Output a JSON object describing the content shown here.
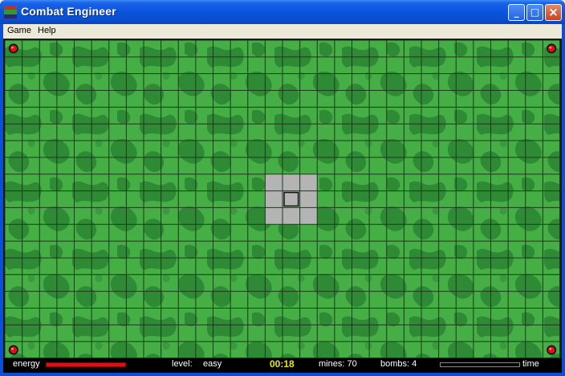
{
  "window": {
    "title": "Combat Engineer",
    "controls": {
      "minimize": "minimize",
      "maximize": "maximize",
      "close": "close"
    }
  },
  "menu": {
    "items": [
      "Game",
      "Help"
    ]
  },
  "board": {
    "columns": 32,
    "rows": 19,
    "revealed_cells": [
      {
        "col": 15,
        "row": 8
      },
      {
        "col": 16,
        "row": 8
      },
      {
        "col": 17,
        "row": 8
      },
      {
        "col": 15,
        "row": 9
      },
      {
        "col": 16,
        "row": 9
      },
      {
        "col": 17,
        "row": 9
      },
      {
        "col": 15,
        "row": 10
      },
      {
        "col": 16,
        "row": 10
      },
      {
        "col": 17,
        "row": 10
      }
    ],
    "player_cell": {
      "col": 16,
      "row": 9
    },
    "corner_markers": [
      "top-left",
      "top-right",
      "bottom-left",
      "bottom-right"
    ],
    "colors": {
      "grass_light": "#44b044",
      "grass_dark": "#2f8a36",
      "grid_line": "#1b3a1b",
      "revealed": "#b4b4b4",
      "marker": "#e01010"
    }
  },
  "status": {
    "energy_label": "energy",
    "energy_level": 1.0,
    "level_label": "level:",
    "level_value": "easy",
    "timer": "00:18",
    "mines_label": "mines: 70",
    "bombs_label": "bombs: 4",
    "time_label": "time",
    "time_level": 0.0
  }
}
